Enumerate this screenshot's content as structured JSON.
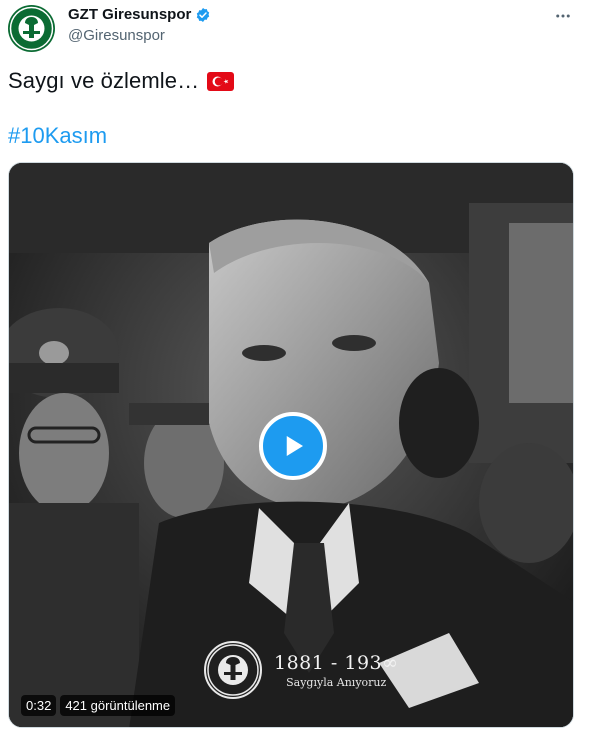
{
  "author": {
    "display_name": "GZT Giresunspor",
    "handle": "@Giresunspor",
    "verified_icon": "verified-badge-icon",
    "avatar_logo_text": "GIRESUNSPOR",
    "avatar_logo_year": "1967"
  },
  "tweet": {
    "text": "Saygı ve özlemle…",
    "flag_icon": "turkey-flag-icon",
    "hashtag": "#10Kasım"
  },
  "video": {
    "duration": "0:32",
    "views": "421 görüntülenme",
    "watermark": {
      "logo_text": "GIRESUNSPOR",
      "logo_year": "1967",
      "years": "1881 - 193∞",
      "subtitle": "Saygıyla Anıyoruz"
    }
  },
  "colors": {
    "accent": "#1d9bf0",
    "club_green": "#0b6b33",
    "flag_red": "#e30a17"
  }
}
